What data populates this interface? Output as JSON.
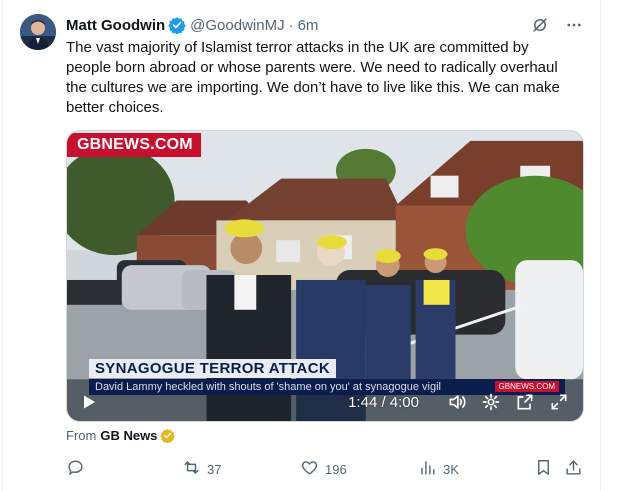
{
  "tweet": {
    "author_name": "Matt Goodwin",
    "author_handle": "@GoodwinMJ",
    "separator": "·",
    "time": "6m",
    "text": "The vast majority of Islamist terror attacks in the UK are committed by people born abroad or whose parents were. We need to radically overhaul the cultures we are importing. We don’t have to live like this. We can make better choices."
  },
  "media": {
    "brand": "GBNEWS.COM",
    "headline": "SYNAGOGUE TERROR ATTACK",
    "subline": "David Lammy heckled with shouts of 'shame on you' at synagogue vigil",
    "source_chip": "GBNEWS.COM",
    "time_display": "1:44 / 4:00"
  },
  "source": {
    "prefix": "From",
    "name": "GB News"
  },
  "actions": {
    "reply_count": "",
    "retweet_count": "37",
    "like_count": "196",
    "views_count": "3K"
  },
  "icons": [
    "verified-badge-icon",
    "grok-icon",
    "more-icon",
    "play-icon",
    "volume-icon",
    "settings-icon",
    "popout-icon",
    "fullscreen-icon",
    "gold-badge-icon",
    "reply-icon",
    "retweet-icon",
    "like-icon",
    "views-icon",
    "bookmark-icon",
    "share-icon"
  ],
  "colors": {
    "accent": "#1d9bf0",
    "text": "#0f1419",
    "muted": "#536471",
    "brand_red": "#c8102e",
    "gold": "#e2b719"
  }
}
